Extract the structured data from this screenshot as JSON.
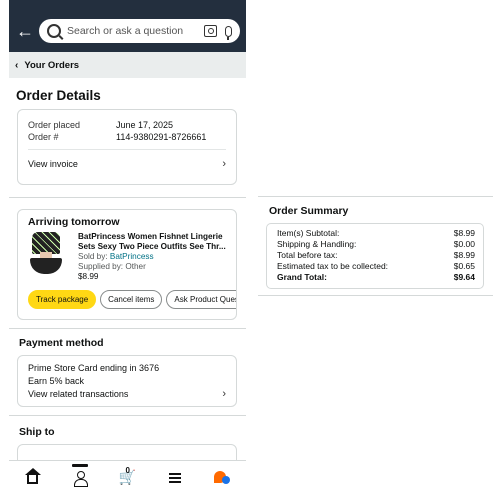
{
  "search": {
    "placeholder": "Search or ask a question"
  },
  "breadcrumb": {
    "label": "Your Orders"
  },
  "page_title": "Order Details",
  "order_info": {
    "placed_label": "Order placed",
    "placed_value": "June 17, 2025",
    "number_label": "Order #",
    "number_value": "114-9380291-8726661",
    "invoice_label": "View invoice"
  },
  "shipment": {
    "heading": "Arriving tomorrow",
    "item_title_line1": "BatPrincess Women Fishnet Lingerie",
    "item_title_line2": "Sets Sexy Two Piece Outfits See Thr...",
    "sold_by_label": "Sold by:",
    "sold_by_value": "BatPrincess",
    "supplied_by": "Supplied by: Other",
    "price": "$8.99",
    "buttons": [
      "Track package",
      "Cancel items",
      "Ask Product Question"
    ]
  },
  "payment": {
    "heading": "Payment method",
    "card": "Prime Store Card  ending in 3676",
    "earn": "Earn 5% back",
    "related": "View related transactions"
  },
  "ship_to": {
    "heading": "Ship to"
  },
  "bottom_nav": {
    "cart_count": "0"
  },
  "order_summary": {
    "heading": "Order Summary",
    "rows": [
      {
        "label": "Item(s) Subtotal:",
        "value": "$8.99"
      },
      {
        "label": "Shipping & Handling:",
        "value": "$0.00"
      },
      {
        "label": "Total before tax:",
        "value": "$8.99"
      },
      {
        "label": "Estimated tax to be collected:",
        "value": "$0.65"
      },
      {
        "label": "Grand Total:",
        "value": "$9.64"
      }
    ]
  },
  "colors": {
    "header": "#232f3e",
    "track_button": "#ffd814",
    "link": "#007185"
  }
}
